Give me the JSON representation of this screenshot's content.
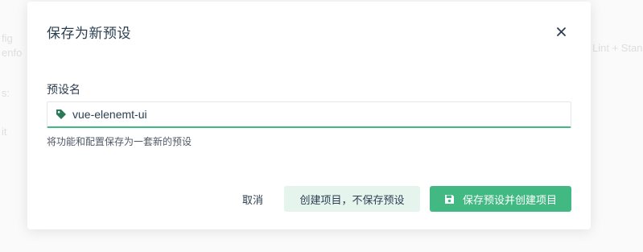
{
  "background": {
    "fragments": [
      "fig",
      "enfo",
      "s:",
      "it",
      "Lint + Stan"
    ]
  },
  "dialog": {
    "title": "保存为新预设",
    "close_icon": "close-icon",
    "field_label": "预设名",
    "input": {
      "value": "vue-elenemt-ui",
      "icon": "tag-icon"
    },
    "hint": "将功能和配置保存为一套新的预设",
    "buttons": {
      "cancel": "取消",
      "create_without_save": "创建项目，不保存预设",
      "save_and_create": "保存预设并创建项目",
      "save_icon": "save-icon"
    }
  },
  "colors": {
    "accent": "#42b983",
    "accent_light": "#e5f5ee",
    "text": "#2c3e50"
  }
}
